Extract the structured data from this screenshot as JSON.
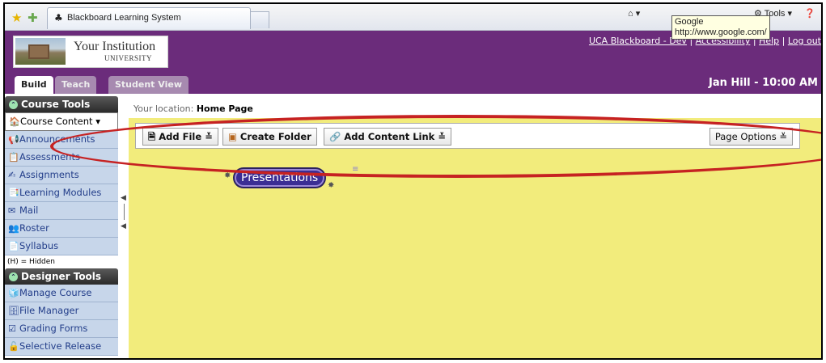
{
  "browser": {
    "tab_title": "Blackboard Learning System",
    "tools_label": "Tools",
    "tooltip_line1": "Google",
    "tooltip_line2": "http://www.google.com/"
  },
  "header": {
    "logo_name": "Your Institution",
    "logo_sub": "UNIVERSITY",
    "links": [
      "UCA Blackboard - Dev",
      "Accessibility",
      "Help",
      "Log out"
    ],
    "tabs": [
      "Build",
      "Teach",
      "Student View"
    ],
    "user_time": "Jan Hill - 10:00 AM"
  },
  "sidebar": {
    "course_tools_title": "Course Tools",
    "course_items": [
      {
        "label": "Course Content",
        "icon": "home-icon"
      },
      {
        "label": "Announcements",
        "icon": "megaphone-icon"
      },
      {
        "label": "Assessments",
        "icon": "assessment-icon"
      },
      {
        "label": "Assignments",
        "icon": "assignment-icon"
      },
      {
        "label": "Learning Modules",
        "icon": "module-icon"
      },
      {
        "label": "Mail",
        "icon": "mail-icon"
      },
      {
        "label": "Roster",
        "icon": "people-icon"
      },
      {
        "label": "Syllabus",
        "icon": "syllabus-icon"
      }
    ],
    "hidden_note": "(H) = Hidden",
    "designer_tools_title": "Designer Tools",
    "designer_items": [
      {
        "label": "Manage Course",
        "icon": "cube-icon"
      },
      {
        "label": "File Manager",
        "icon": "file-manager-icon"
      },
      {
        "label": "Grading Forms",
        "icon": "grading-icon"
      },
      {
        "label": "Selective Release",
        "icon": "release-icon"
      }
    ]
  },
  "main": {
    "location_label": "Your location:",
    "location_value": "Home Page",
    "add_file": "Add File",
    "create_folder": "Create Folder",
    "add_content_link": "Add Content Link",
    "page_options": "Page Options",
    "presentations": "Presentations"
  },
  "colors": {
    "header_purple": "#6b2c7b",
    "content_yellow": "#f2ec7c",
    "annotation_red": "#c62222"
  }
}
